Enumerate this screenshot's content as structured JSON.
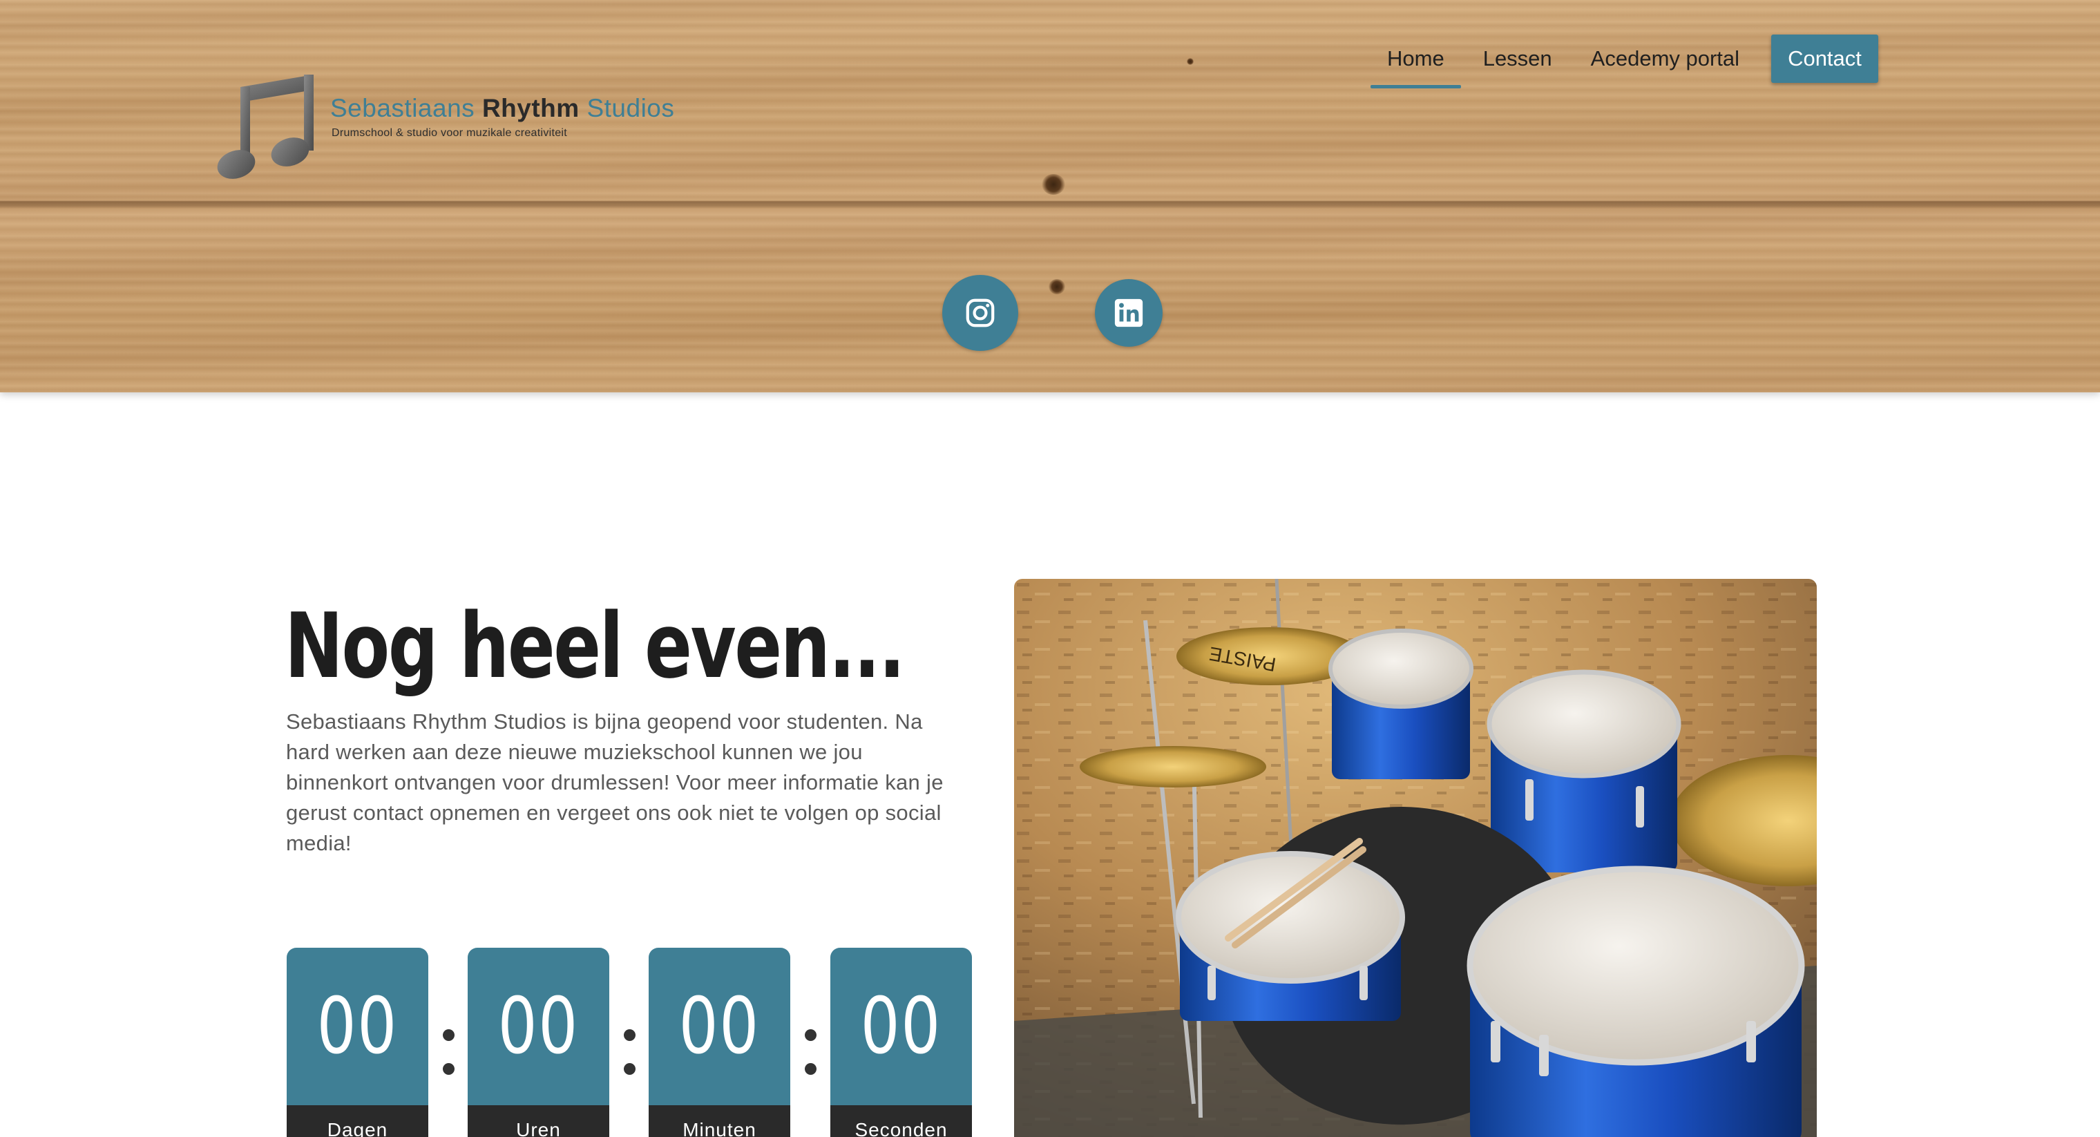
{
  "brand": {
    "name_part1": "Sebastiaans",
    "name_part2": "Rhythm",
    "name_part3": "Studios",
    "tagline": "Drumschool & studio voor muzikale creativiteit"
  },
  "nav": {
    "items": [
      {
        "label": "Home",
        "active": true
      },
      {
        "label": "Lessen",
        "active": false
      },
      {
        "label": "Acedemy portal",
        "active": false
      }
    ],
    "contact_label": "Contact"
  },
  "social": [
    {
      "icon": "instagram-icon"
    },
    {
      "icon": "linkedin-icon"
    }
  ],
  "main": {
    "heading": "Nog heel even...",
    "intro": "Sebastiaans Rhythm Studios is bijna geopend voor studenten. Na hard werken aan deze nieuwe muziekschool kunnen we jou binnenkort ontvangen voor drumlessen! Voor meer informatie kan je gerust contact opnemen en vergeet ons ook niet te volgen op social media!"
  },
  "countdown": [
    {
      "value": "00",
      "label": "Dagen"
    },
    {
      "value": "00",
      "label": "Uren"
    },
    {
      "value": "00",
      "label": "Minuten"
    },
    {
      "value": "00",
      "label": "Seconden"
    }
  ],
  "colors": {
    "accent": "#3f7f95",
    "dark": "#2a2a2a",
    "text": "#5a5a5a"
  }
}
